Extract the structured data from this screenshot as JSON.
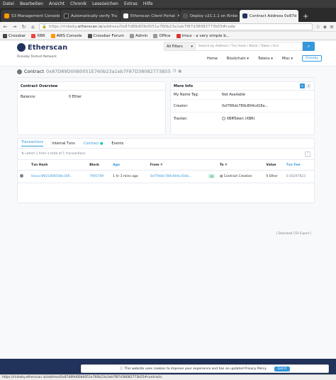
{
  "menu": [
    "Datei",
    "Bearbeiten",
    "Ansicht",
    "Chronik",
    "Lesezeichen",
    "Extras",
    "Hilfe"
  ],
  "tabs": [
    {
      "label": "S3 Management Console",
      "color": "#ff9900",
      "active": false
    },
    {
      "label": "Automatically verify Tru",
      "color": "#24292e",
      "active": false
    },
    {
      "label": "Etherscan Client Portal",
      "color": "#ffffff",
      "active": false
    },
    {
      "label": "Deploy v21.1.1 on Rinke",
      "color": "#2b2b2b",
      "active": false
    },
    {
      "label": "Contract Address 0x87d",
      "color": "#21325b",
      "active": true
    }
  ],
  "url": {
    "prefix": "https://rinkeby.",
    "host": "etherscan.io",
    "path": "/address/0x87d89d00b0051e760b23a1eb7f87d38082773b55#code"
  },
  "bookmarks": [
    {
      "label": "Crossbar",
      "color": "#444"
    },
    {
      "label": "XBR",
      "color": "#e44"
    },
    {
      "label": "AWS Console",
      "color": "#ff9900"
    },
    {
      "label": "Crossbar Forum",
      "color": "#555"
    },
    {
      "label": "Admin",
      "color": "#999"
    },
    {
      "label": "Office",
      "color": "#999"
    },
    {
      "label": "tmux - a very simple b...",
      "color": "#d33"
    }
  ],
  "header": {
    "logo": "Etherscan",
    "network": "Rinkeby Testnet Network",
    "filter": "All Filters",
    "search_placeholder": "Search by Address / Txn Hash / Block / Token / Ens",
    "nav": [
      "Home",
      "Blockchain",
      "Tokens",
      "Misc"
    ],
    "signin": "Rinkeby"
  },
  "title": {
    "label": "Contract",
    "address": "0x87D89D00B0051E760b23a1eb7F87D38082773B55"
  },
  "overview": {
    "heading": "Contract Overview",
    "balance_label": "Balance:",
    "balance_value": "0 Ether"
  },
  "more_info": {
    "heading": "More Info",
    "rows": [
      {
        "k": "My Name Tag:",
        "v": "Not Available"
      },
      {
        "k": "Creator:",
        "v": "0xf766dc789c804cd18a..."
      },
      {
        "k": "Tracker:",
        "v": "XBRToken (XBR)"
      }
    ]
  },
  "txtabs": [
    "Transactions",
    "Internal Txns",
    "Contract",
    "Events"
  ],
  "latest": "Latest 1 from a total of 1 transactions",
  "columns": [
    "Txn Hash",
    "Block",
    "Age",
    "From",
    "To",
    "Value",
    "Txn Fee"
  ],
  "rows": [
    {
      "hash": "0xacc4f821808508c306...",
      "block": "7905709",
      "age": "1 hr 3 mins ago",
      "from": "0xf766dc789c804cd18a...",
      "dir": "IN",
      "to": "Contract Creation",
      "value": "0 Ether",
      "fee": "0.00297823"
    }
  ],
  "download": "[ Download CSV Export ]",
  "cookie": {
    "text": "This website uses cookies to improve your experience and has an updated Privacy Policy.",
    "button": "Got It"
  },
  "status": "https://rinkeby.etherscan.io/address/0x87d89d00b0051e760b23a1eb7f87d38082773b55#contracts"
}
